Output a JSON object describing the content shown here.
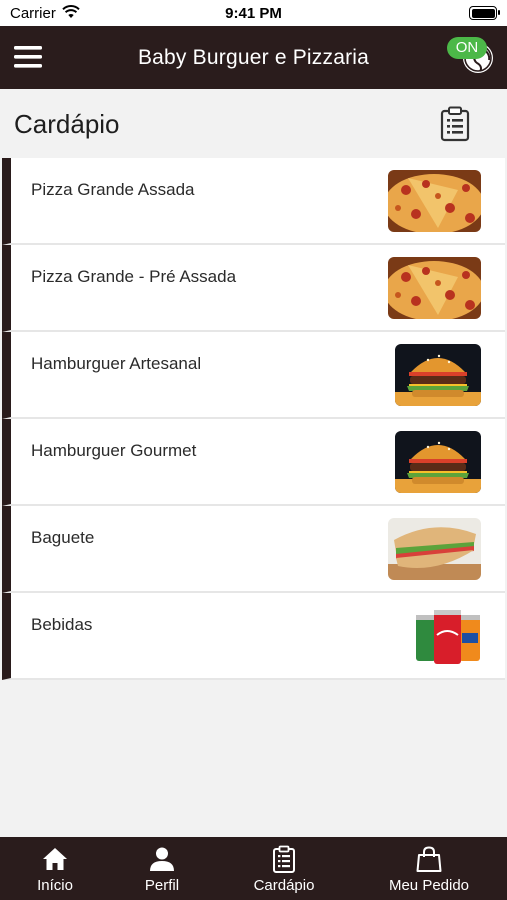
{
  "status_bar": {
    "carrier": "Carrier",
    "time": "9:41 PM"
  },
  "header": {
    "title": "Baby Burguer e Pizzaria",
    "status_badge": "ON"
  },
  "page": {
    "title": "Cardápio"
  },
  "menu_items": [
    {
      "label": "Pizza Grande Assada",
      "image": "pizza-photo"
    },
    {
      "label": "Pizza Grande - Pré Assada",
      "image": "pizza-photo"
    },
    {
      "label": "Hamburguer Artesanal",
      "image": "burger-photo"
    },
    {
      "label": "Hamburguer Gourmet",
      "image": "burger-photo"
    },
    {
      "label": "Baguete",
      "image": "baguette-photo"
    },
    {
      "label": "Bebidas",
      "image": "soda-cans-photo"
    }
  ],
  "tabs": [
    {
      "label": "Início",
      "icon": "home-icon"
    },
    {
      "label": "Perfil",
      "icon": "person-icon"
    },
    {
      "label": "Cardápio",
      "icon": "clipboard-icon"
    },
    {
      "label": "Meu Pedido",
      "icon": "bag-icon"
    }
  ],
  "colors": {
    "brand_dark": "#2a1c1c",
    "online_green": "#4cb848",
    "background": "#f2f2f2"
  }
}
